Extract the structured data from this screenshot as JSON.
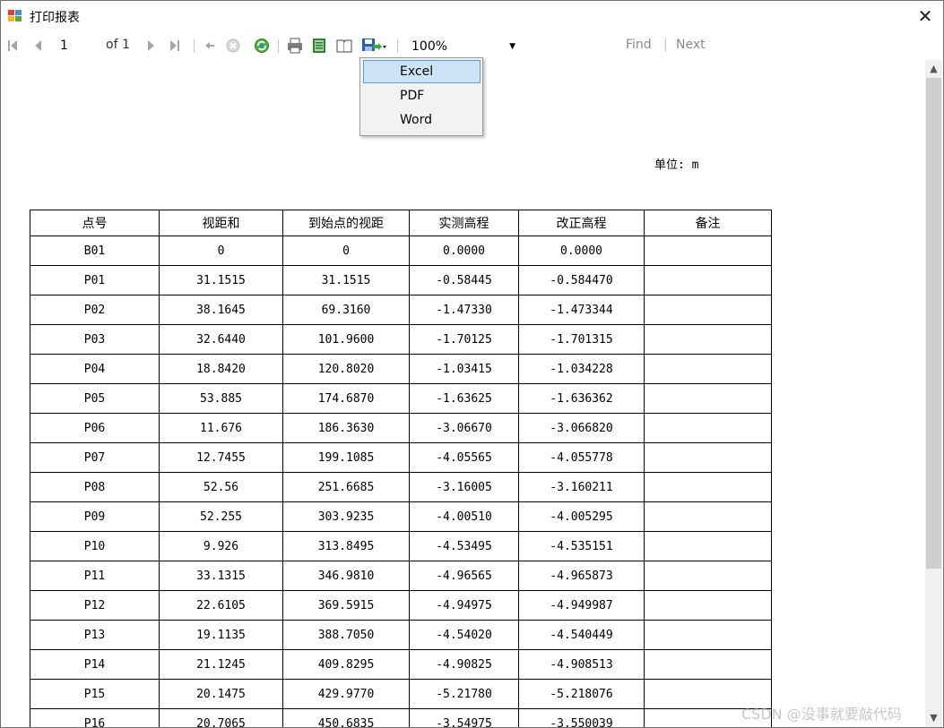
{
  "window": {
    "title": "打印报表",
    "close_label": "✕"
  },
  "toolbar": {
    "page_value": "1",
    "of_label": "of 1",
    "zoom_value": "100%",
    "find_label": "Find",
    "separator": "|",
    "next_label": "Next"
  },
  "export_menu": {
    "items": [
      "Excel",
      "PDF",
      "Word"
    ],
    "selected": "Excel"
  },
  "report": {
    "unit_label": "单位: m",
    "headers": [
      "点号",
      "视距和",
      "到始点的视距",
      "实测高程",
      "改正高程",
      "备注"
    ],
    "rows": [
      [
        "B01",
        "0",
        "0",
        "0.0000",
        "0.0000",
        ""
      ],
      [
        "P01",
        "31.1515",
        "31.1515",
        "-0.58445",
        "-0.584470",
        ""
      ],
      [
        "P02",
        "38.1645",
        "69.3160",
        "-1.47330",
        "-1.473344",
        ""
      ],
      [
        "P03",
        "32.6440",
        "101.9600",
        "-1.70125",
        "-1.701315",
        ""
      ],
      [
        "P04",
        "18.8420",
        "120.8020",
        "-1.03415",
        "-1.034228",
        ""
      ],
      [
        "P05",
        "53.885",
        "174.6870",
        "-1.63625",
        "-1.636362",
        ""
      ],
      [
        "P06",
        "11.676",
        "186.3630",
        "-3.06670",
        "-3.066820",
        ""
      ],
      [
        "P07",
        "12.7455",
        "199.1085",
        "-4.05565",
        "-4.055778",
        ""
      ],
      [
        "P08",
        "52.56",
        "251.6685",
        "-3.16005",
        "-3.160211",
        ""
      ],
      [
        "P09",
        "52.255",
        "303.9235",
        "-4.00510",
        "-4.005295",
        ""
      ],
      [
        "P10",
        "9.926",
        "313.8495",
        "-4.53495",
        "-4.535151",
        ""
      ],
      [
        "P11",
        "33.1315",
        "346.9810",
        "-4.96565",
        "-4.965873",
        ""
      ],
      [
        "P12",
        "22.6105",
        "369.5915",
        "-4.94975",
        "-4.949987",
        ""
      ],
      [
        "P13",
        "19.1135",
        "388.7050",
        "-4.54020",
        "-4.540449",
        ""
      ],
      [
        "P14",
        "21.1245",
        "409.8295",
        "-4.90825",
        "-4.908513",
        ""
      ],
      [
        "P15",
        "20.1475",
        "429.9770",
        "-5.21780",
        "-5.218076",
        ""
      ],
      [
        "P16",
        "20.7065",
        "450.6835",
        "-3.54975",
        "-3.550039",
        ""
      ]
    ]
  },
  "watermark": "CSDN @没事就要敲代码",
  "colors": {
    "menu_highlight": "#cce4f7",
    "menu_highlight_border": "#5b9bd5",
    "toolbar_icon_disabled": "#9aa0a6"
  }
}
